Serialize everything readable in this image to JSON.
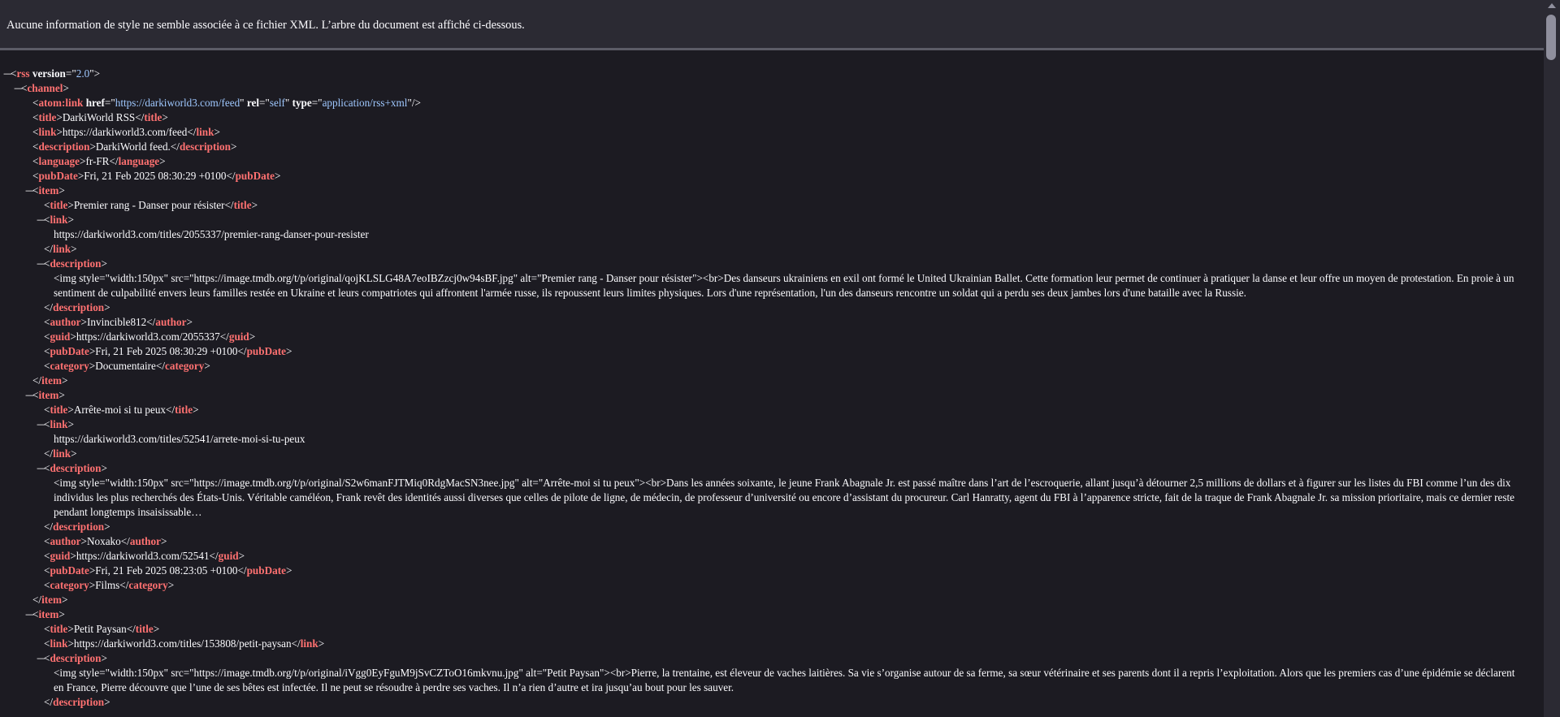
{
  "info": "Aucune information de style ne semble associée à ce fichier XML. L’arbre du document est affiché ci-dessous.",
  "rss": {
    "tag": "rss",
    "attr_version": "version",
    "version": "2.0"
  },
  "channel": {
    "tag": "channel",
    "atom": {
      "tag": "atom:link",
      "attr_href": "href",
      "href": "https://darkiworld3.com/feed",
      "attr_rel": "rel",
      "rel": "self",
      "attr_type": "type",
      "type": "application/rss+xml"
    },
    "title_tag": "title",
    "title": "DarkiWorld RSS",
    "link_tag": "link",
    "link": "https://darkiworld3.com/feed",
    "description_tag": "description",
    "description": "DarkiWorld feed.",
    "language_tag": "language",
    "language": "fr-FR",
    "pubdate_tag": "pubDate",
    "pubdate": "Fri, 21 Feb 2025 08:30:29 +0100"
  },
  "tags": {
    "item": "item",
    "title": "title",
    "link": "link",
    "description": "description",
    "author": "author",
    "guid": "guid",
    "pubdate": "pubDate",
    "category": "category"
  },
  "items": [
    {
      "title": "Premier rang - Danser pour résister",
      "link": "https://darkiworld3.com/titles/2055337/premier-rang-danser-pour-resister",
      "description": "<img style=\"width:150px\" src=\"https://image.tmdb.org/t/p/original/qojKLSLG48A7eoIBZzcj0w94sBF.jpg\" alt=\"Premier rang - Danser pour résister\"><br>Des danseurs ukrainiens en exil ont formé le United Ukrainian Ballet. Cette formation leur permet de continuer à pratiquer la danse et leur offre un moyen de protestation. En proie à un sentiment de culpabilité envers leurs familles restée en Ukraine et leurs compatriotes qui affrontent l'armée russe, ils repoussent leurs limites physiques. Lors d'une représentation, l'un des danseurs rencontre un soldat qui a perdu ses deux jambes lors d'une bataille avec la Russie.",
      "author": "Invincible812",
      "guid": "https://darkiworld3.com/2055337",
      "pubdate": "Fri, 21 Feb 2025 08:30:29 +0100",
      "category": "Documentaire"
    },
    {
      "title": "Arrête-moi si tu peux",
      "link": "https://darkiworld3.com/titles/52541/arrete-moi-si-tu-peux",
      "description": "<img style=\"width:150px\" src=\"https://image.tmdb.org/t/p/original/S2w6manFJTMiq0RdgMacSN3nee.jpg\" alt=\"Arrête-moi si tu peux\"><br>Dans les années soixante, le jeune Frank Abagnale Jr. est passé maître dans l’art de l’escroquerie, allant jusqu’à détourner 2,5 millions de dollars et à figurer sur les listes du FBI comme l’un des dix individus les plus recherchés des États-Unis. Véritable caméléon, Frank revêt des identités aussi diverses que celles de pilote de ligne, de médecin, de professeur d’université ou encore d’assistant du procureur. Carl Hanratty, agent du FBI à l’apparence stricte, fait de la traque de Frank Abagnale Jr. sa mission prioritaire, mais ce dernier reste pendant longtemps insaisissable…",
      "author": "Noxako",
      "guid": "https://darkiworld3.com/52541",
      "pubdate": "Fri, 21 Feb 2025 08:23:05 +0100",
      "category": "Films"
    },
    {
      "title": "Petit Paysan",
      "link": "https://darkiworld3.com/titles/153808/petit-paysan",
      "description": "<img style=\"width:150px\" src=\"https://image.tmdb.org/t/p/original/iVgg0EyFguM9jSvCZToO16mkvnu.jpg\" alt=\"Petit Paysan\"><br>Pierre, la trentaine, est éleveur de vaches laitières. Sa vie s’organise autour de sa ferme, sa sœur vétérinaire et ses parents dont il a repris l’exploitation. Alors que les premiers cas d’une épidémie se déclarent en France, Pierre découvre que l’une de ses bêtes est infectée. Il ne peut se résoudre à perdre ses vaches. Il n’a rien d’autre et ira jusqu’au bout pour les sauver."
    }
  ],
  "toggle_glyph": "—"
}
